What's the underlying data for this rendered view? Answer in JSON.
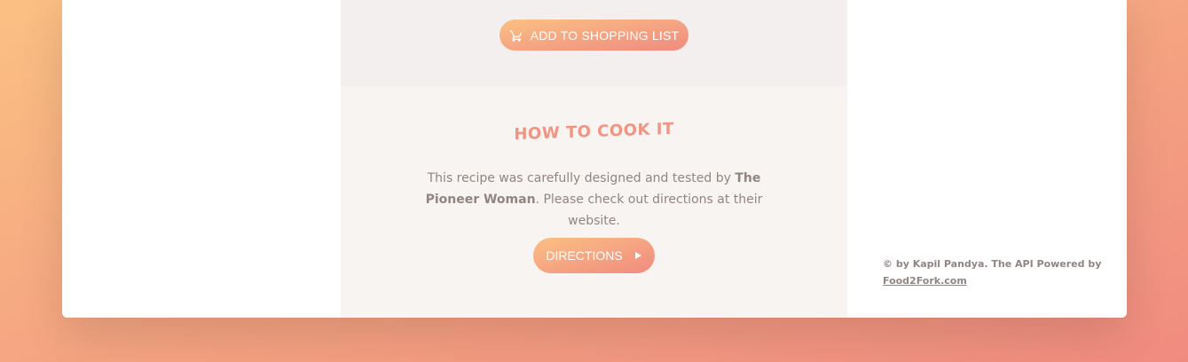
{
  "ingredients": {
    "add_to_list_label": "ADD TO SHOPPING LIST",
    "cart_icon": "shopping-cart-icon"
  },
  "directions": {
    "heading": "HOW TO COOK IT",
    "text_before": "This recipe was carefully designed and tested by ",
    "publisher": "The Pioneer Woman",
    "text_after": ". Please check out directions at their website.",
    "button_label": "DIRECTIONS",
    "button_icon": "triangle-right-icon"
  },
  "footer": {
    "copyright_text": "© by Kapil Pandya. The API Powered by ",
    "api_link": "Food2Fork.com"
  },
  "colors": {
    "gradient_start": "#fbc083",
    "gradient_end": "#f08b80",
    "text": "#918581",
    "heading": "#f09483"
  }
}
